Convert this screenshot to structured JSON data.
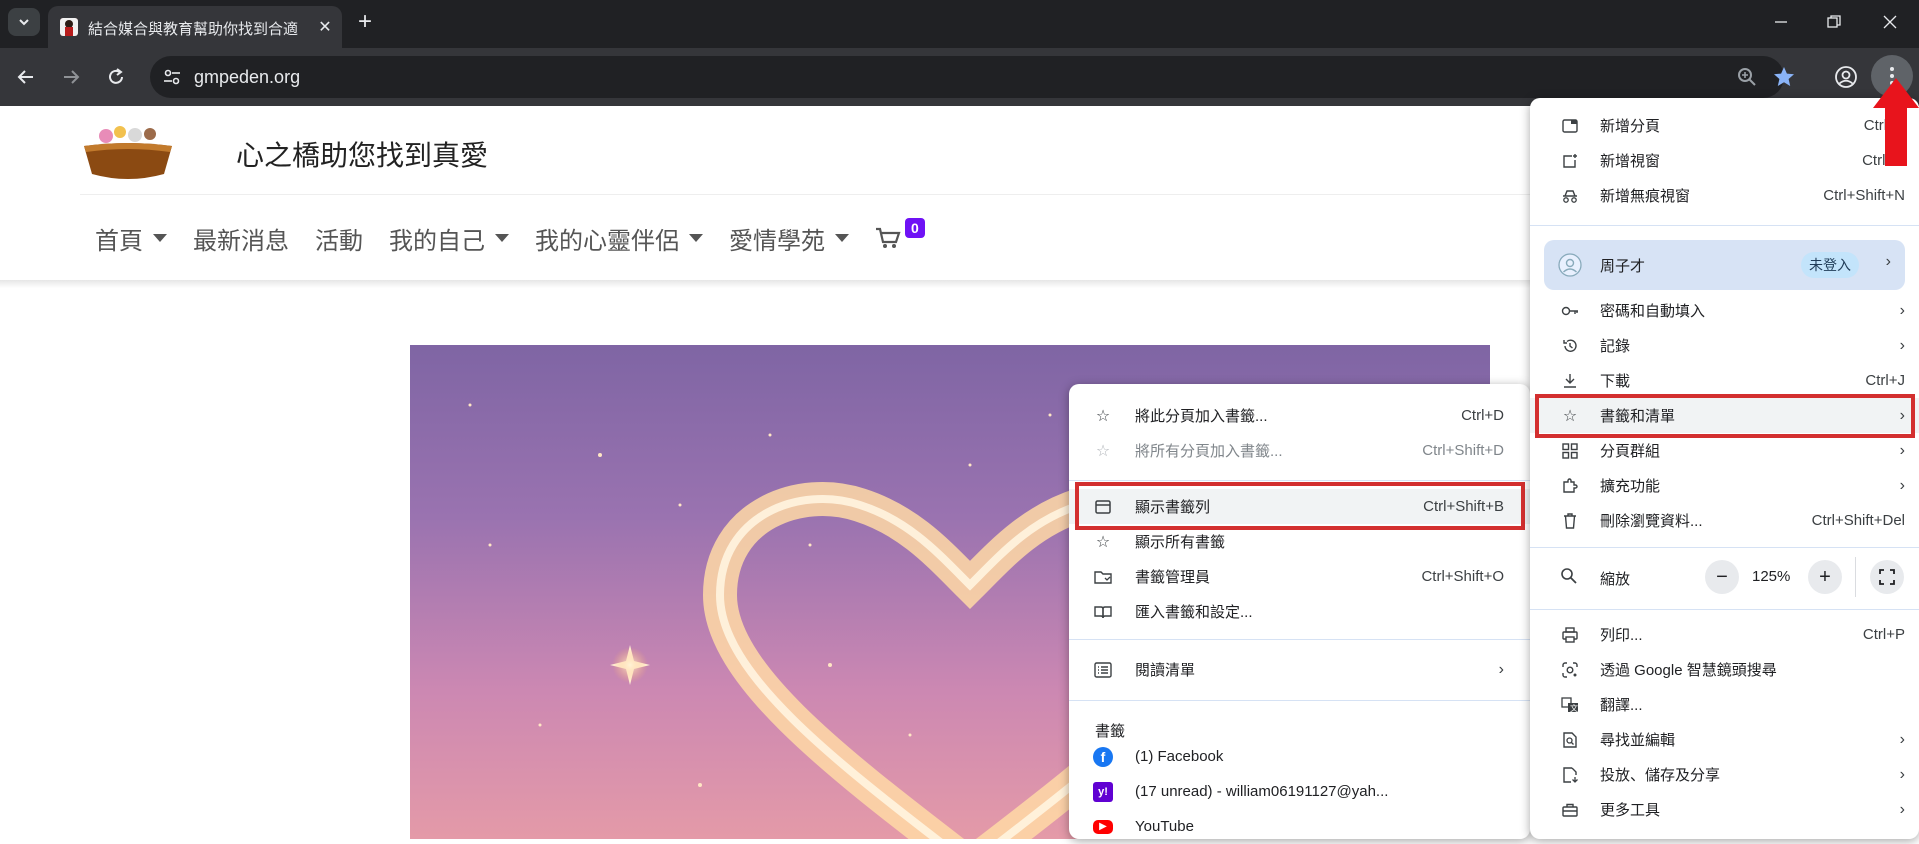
{
  "browser": {
    "tab_title": "結合媒合與教育幫助你找到合適",
    "url": "gmpeden.org"
  },
  "site": {
    "title": "心之橋助您找到真愛",
    "nav": [
      {
        "label": "首頁",
        "dropdown": true
      },
      {
        "label": "最新消息",
        "dropdown": false
      },
      {
        "label": "活動",
        "dropdown": false
      },
      {
        "label": "我的自己",
        "dropdown": true
      },
      {
        "label": "我的心靈伴侶",
        "dropdown": true
      },
      {
        "label": "愛情學苑",
        "dropdown": true
      }
    ],
    "cart_count": "0"
  },
  "main_menu": {
    "items_top": [
      {
        "icon": "new-tab-icon",
        "label": "新增分頁",
        "shortcut": "Ctrl+T"
      },
      {
        "icon": "new-window-icon",
        "label": "新增視窗",
        "shortcut": "Ctrl+N"
      },
      {
        "icon": "incognito-icon",
        "label": "新增無痕視窗",
        "shortcut": "Ctrl+Shift+N"
      }
    ],
    "profile": {
      "name": "周子才",
      "status": "未登入"
    },
    "items_mid": [
      {
        "icon": "key-icon",
        "label": "密碼和自動填入",
        "shortcut": "",
        "submenu": true
      },
      {
        "icon": "history-icon",
        "label": "記錄",
        "shortcut": "",
        "submenu": true
      },
      {
        "icon": "download-icon",
        "label": "下載",
        "shortcut": "Ctrl+J",
        "submenu": false
      },
      {
        "icon": "star-icon",
        "label": "書籤和清單",
        "shortcut": "",
        "submenu": true
      },
      {
        "icon": "tab-groups-icon",
        "label": "分頁群組",
        "shortcut": "",
        "submenu": true
      },
      {
        "icon": "extensions-icon",
        "label": "擴充功能",
        "shortcut": "",
        "submenu": true
      },
      {
        "icon": "trash-icon",
        "label": "刪除瀏覽資料...",
        "shortcut": "Ctrl+Shift+Del",
        "submenu": false
      }
    ],
    "zoom": {
      "label": "縮放",
      "minus": "−",
      "value": "125%",
      "plus": "+"
    },
    "items_bottom": [
      {
        "icon": "print-icon",
        "label": "列印...",
        "shortcut": "Ctrl+P",
        "submenu": false
      },
      {
        "icon": "google-lens-icon",
        "label": "透過 Google 智慧鏡頭搜尋",
        "shortcut": "",
        "submenu": false
      },
      {
        "icon": "translate-icon",
        "label": "翻譯...",
        "shortcut": "",
        "submenu": false
      },
      {
        "icon": "find-icon",
        "label": "尋找並編輯",
        "shortcut": "",
        "submenu": true
      },
      {
        "icon": "cast-save-share-icon",
        "label": "投放、儲存及分享",
        "shortcut": "",
        "submenu": true
      },
      {
        "icon": "toolbox-icon",
        "label": "更多工具",
        "shortcut": "",
        "submenu": true
      }
    ]
  },
  "bookmarks_menu": {
    "items": [
      {
        "icon": "star-icon",
        "label": "將此分頁加入書籤...",
        "shortcut": "Ctrl+D",
        "disabled": false
      },
      {
        "icon": "star-icon",
        "label": "將所有分頁加入書籤...",
        "shortcut": "Ctrl+Shift+D",
        "disabled": true
      }
    ],
    "items2": [
      {
        "icon": "bookmark-bar-icon",
        "label": "顯示書籤列",
        "shortcut": "Ctrl+Shift+B"
      },
      {
        "icon": "star-icon",
        "label": "顯示所有書籤",
        "shortcut": ""
      },
      {
        "icon": "folder-icon",
        "label": "書籤管理員",
        "shortcut": "Ctrl+Shift+O"
      },
      {
        "icon": "import-icon",
        "label": "匯入書籤和設定...",
        "shortcut": ""
      }
    ],
    "reading_list": "閱讀清單",
    "bookmarks_header": "書籤",
    "bookmarks": [
      {
        "icon": "facebook-icon",
        "label": "(1) Facebook",
        "color": "#1877f2",
        "glyph": "f"
      },
      {
        "icon": "yahoo-icon",
        "label": "(17 unread) - william06191127@yah...",
        "color": "#6001d2",
        "glyph": "y!"
      },
      {
        "icon": "youtube-icon",
        "label": "YouTube",
        "color": "#ff0000",
        "glyph": "▶"
      }
    ]
  },
  "colors": {
    "highlight": "#d32f2f",
    "arrow": "#e8141c"
  }
}
